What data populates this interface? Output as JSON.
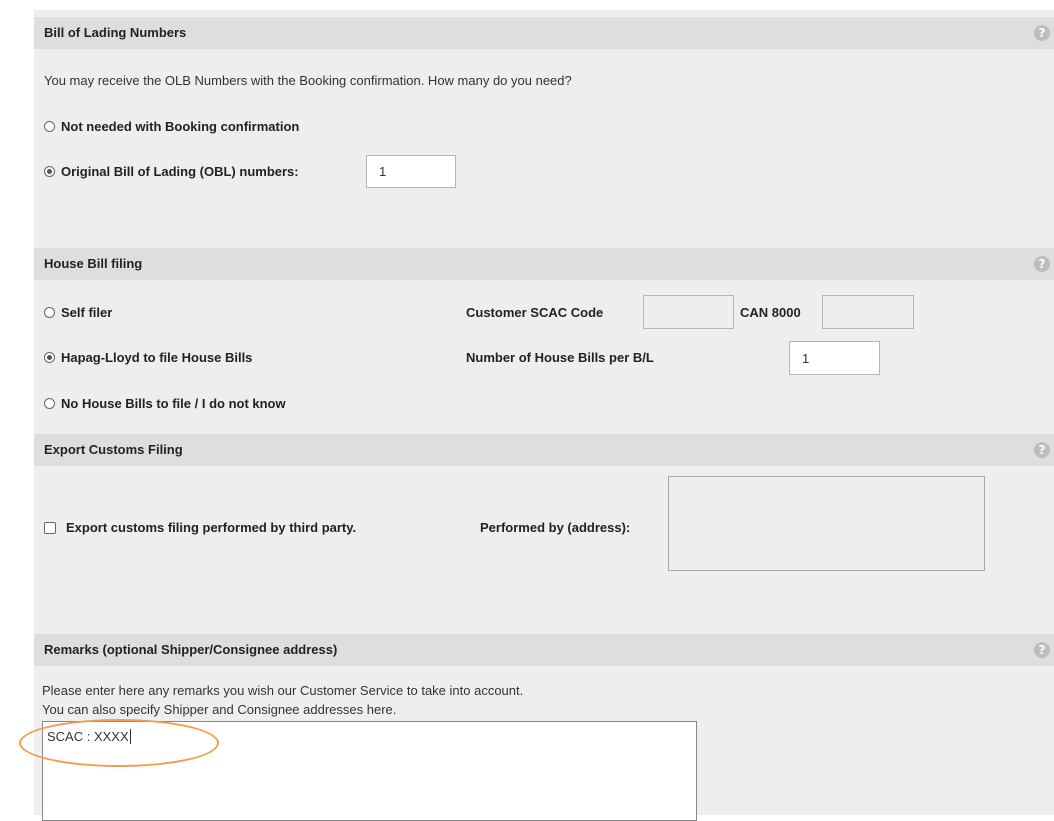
{
  "bill_of_lading": {
    "title": "Bill of Lading Numbers",
    "intro": "You may receive the OLB Numbers with the Booking confirmation. How many do you need?",
    "option_not_needed": "Not needed with Booking confirmation",
    "option_obl": "Original Bill of Lading (OBL) numbers:",
    "obl_value": "1",
    "selected": "obl"
  },
  "house_bill": {
    "title": "House Bill filing",
    "option_self_filer": "Self filer",
    "option_hapag": "Hapag-Lloyd to file House Bills",
    "option_none": "No House Bills to file / I do not know",
    "selected": "hapag",
    "scac_label": "Customer SCAC Code",
    "scac_value": "",
    "can_label": "CAN 8000",
    "can_value": "",
    "count_label": "Number of House Bills per B/L",
    "count_value": "1"
  },
  "export_customs": {
    "title": "Export Customs Filing",
    "checkbox_label": "Export customs filing performed by third party.",
    "checked": false,
    "performed_by_label": "Performed by (address):",
    "performed_by_value": ""
  },
  "remarks": {
    "title": "Remarks (optional Shipper/Consignee address)",
    "line1": "Please enter here any remarks you wish our Customer Service to take into account.",
    "line2": "You can also specify Shipper and Consignee addresses here.",
    "value": "SCAC : XXXX"
  },
  "help_icon_glyph": "?",
  "colors": {
    "panel": "#eeeeee",
    "header": "#dedede",
    "annotation": "#f39c4a"
  }
}
